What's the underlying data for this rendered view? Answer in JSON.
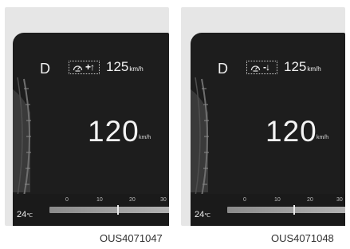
{
  "panels": [
    {
      "gear": "D",
      "cruise_icon": "cruise-speed-icon",
      "cruise_change": "+↑",
      "set_speed": "125",
      "set_speed_unit": "km/h",
      "speed": "120",
      "speed_unit": "km/h",
      "temperature": "24",
      "temperature_unit": "℃",
      "ticks": [
        "0",
        "10",
        "20",
        "30"
      ],
      "caption": "OUS4071047"
    },
    {
      "gear": "D",
      "cruise_icon": "cruise-speed-icon",
      "cruise_change": "-↓",
      "set_speed": "125",
      "set_speed_unit": "km/h",
      "speed": "120",
      "speed_unit": "km/h",
      "temperature": "24",
      "temperature_unit": "℃",
      "ticks": [
        "0",
        "10",
        "20",
        "30"
      ],
      "caption": "OUS4071048"
    }
  ]
}
